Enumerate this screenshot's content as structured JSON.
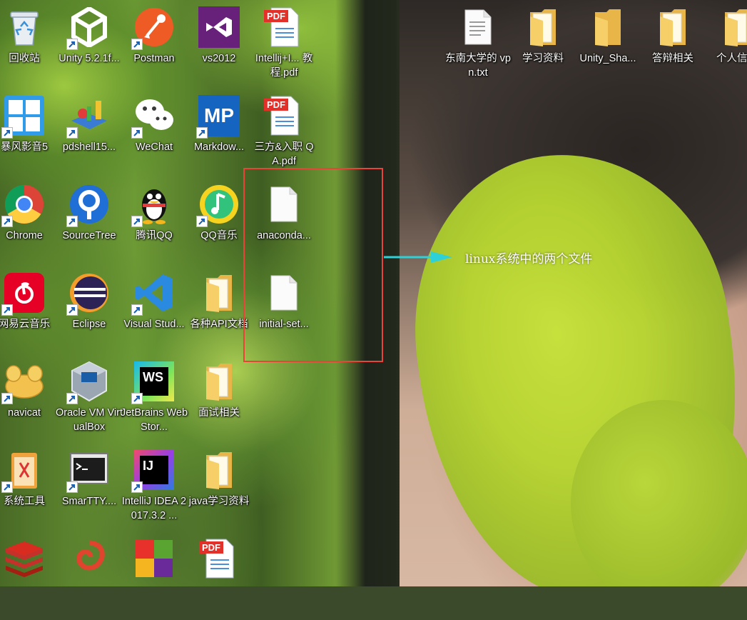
{
  "desktop": {
    "icons": [
      {
        "label": "回收站"
      },
      {
        "label": "Unity 5.2.1f..."
      },
      {
        "label": "Postman"
      },
      {
        "label": "vs2012"
      },
      {
        "label": "Intellij+I... 教程.pdf"
      },
      {
        "label": "东南大学的 vpn.txt"
      },
      {
        "label": "学习资料"
      },
      {
        "label": "Unity_Sha..."
      },
      {
        "label": "答辩相关"
      },
      {
        "label": "个人信"
      },
      {
        "label": "暴风影音5"
      },
      {
        "label": "pdshell15..."
      },
      {
        "label": "WeChat"
      },
      {
        "label": "Markdow..."
      },
      {
        "label": "三方&入职 QA.pdf"
      },
      {
        "label": "Chrome"
      },
      {
        "label": "SourceTree"
      },
      {
        "label": "腾讯QQ"
      },
      {
        "label": "QQ音乐"
      },
      {
        "label": "anaconda..."
      },
      {
        "label": "网易云音乐"
      },
      {
        "label": "Eclipse"
      },
      {
        "label": "Visual Stud..."
      },
      {
        "label": "各种API文档"
      },
      {
        "label": "initial-set..."
      },
      {
        "label": "navicat"
      },
      {
        "label": "Oracle VM VirtualBox"
      },
      {
        "label": "JetBrains WebStor..."
      },
      {
        "label": "面试相关"
      },
      {
        "label": "系统工具"
      },
      {
        "label": "SmarTTY...."
      },
      {
        "label": "IntelliJ IDEA 2017.3.2 ..."
      },
      {
        "label": "java学习资料"
      }
    ],
    "tile_text": {
      "pdf": "PDF",
      "markdownpad": "MP",
      "webstorm": "WS",
      "idea": "IJ"
    }
  },
  "annotation": {
    "text": "linux系统中的两个文件",
    "box_color": "#e8443a",
    "arrow_color": "#2fd1d8"
  }
}
